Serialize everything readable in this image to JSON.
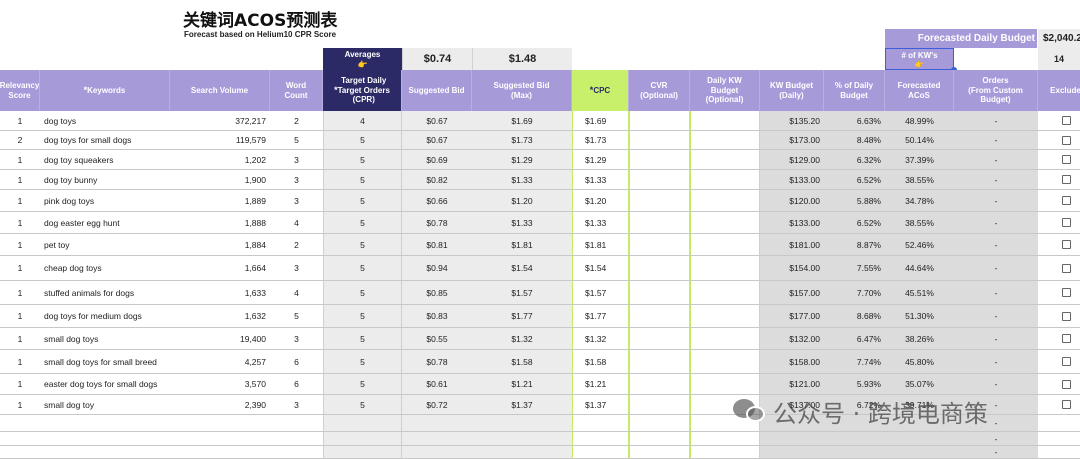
{
  "title": "关键词ACOS预测表",
  "subtitle": "Forecast based on Helium10 CPR Score",
  "averages": {
    "label": "Averages",
    "hand": "👉",
    "suggested_bid": "$0.74",
    "suggested_bid_max": "$1.48"
  },
  "forecast": {
    "label": "Forecasted Daily Budget",
    "value": "$2,040.2",
    "kw_label": "# of KW's",
    "kw_hand": "👉",
    "kw_count": "14"
  },
  "columns": [
    {
      "key": "relevancy",
      "label": "Relevancy\nScore"
    },
    {
      "key": "keyword",
      "label": "Keywords",
      "star": "*"
    },
    {
      "key": "volume",
      "label": "Search Volume"
    },
    {
      "key": "words",
      "label": "Word\nCount"
    },
    {
      "key": "target",
      "label": "Target Daily\nTarget Orders\n(CPR)",
      "star": "*"
    },
    {
      "key": "bid",
      "label": "Suggested Bid"
    },
    {
      "key": "bidmax",
      "label": "Suggested Bid\n(Max)"
    },
    {
      "key": "cpc",
      "label": "CPC",
      "star": "*"
    },
    {
      "key": "cvr",
      "label": "CVR\n(Optional)"
    },
    {
      "key": "dkw",
      "label": "Daily KW\nBudget\n(Optional)"
    },
    {
      "key": "kwb",
      "label": "KW Budget\n(Daily)"
    },
    {
      "key": "pct",
      "label": "% of Daily\nBudget"
    },
    {
      "key": "facos",
      "label": "Forecasted\nACoS"
    },
    {
      "key": "orders",
      "label": "Orders\n(From Custom\nBudget)"
    },
    {
      "key": "exclude",
      "label": "Exclude"
    }
  ],
  "rows": [
    {
      "relevancy": "1",
      "keyword": "dog toys",
      "volume": "372,217",
      "words": "2",
      "target": "4",
      "bid": "$0.67",
      "bidmax": "$1.69",
      "cpc": "$1.69",
      "kwb": "$135.20",
      "pct": "6.63%",
      "facos": "48.99%",
      "orders": "-"
    },
    {
      "relevancy": "2",
      "keyword": "dog toys for small dogs",
      "volume": "119,579",
      "words": "5",
      "target": "5",
      "bid": "$0.67",
      "bidmax": "$1.73",
      "cpc": "$1.73",
      "kwb": "$173.00",
      "pct": "8.48%",
      "facos": "50.14%",
      "orders": "-"
    },
    {
      "relevancy": "1",
      "keyword": "dog toy squeakers",
      "volume": "1,202",
      "words": "3",
      "target": "5",
      "bid": "$0.69",
      "bidmax": "$1.29",
      "cpc": "$1.29",
      "kwb": "$129.00",
      "pct": "6.32%",
      "facos": "37.39%",
      "orders": "-"
    },
    {
      "relevancy": "1",
      "keyword": "dog toy bunny",
      "volume": "1,900",
      "words": "3",
      "target": "5",
      "bid": "$0.82",
      "bidmax": "$1.33",
      "cpc": "$1.33",
      "kwb": "$133.00",
      "pct": "6.52%",
      "facos": "38.55%",
      "orders": "-"
    },
    {
      "relevancy": "1",
      "keyword": "pink dog toys",
      "volume": "1,889",
      "words": "3",
      "target": "5",
      "bid": "$0.66",
      "bidmax": "$1.20",
      "cpc": "$1.20",
      "kwb": "$120.00",
      "pct": "5.88%",
      "facos": "34.78%",
      "orders": "-"
    },
    {
      "relevancy": "1",
      "keyword": "dog easter egg hunt",
      "volume": "1,888",
      "words": "4",
      "target": "5",
      "bid": "$0.78",
      "bidmax": "$1.33",
      "cpc": "$1.33",
      "kwb": "$133.00",
      "pct": "6.52%",
      "facos": "38.55%",
      "orders": "-"
    },
    {
      "relevancy": "1",
      "keyword": "pet toy",
      "volume": "1,884",
      "words": "2",
      "target": "5",
      "bid": "$0.81",
      "bidmax": "$1.81",
      "cpc": "$1.81",
      "kwb": "$181.00",
      "pct": "8.87%",
      "facos": "52.46%",
      "orders": "-"
    },
    {
      "relevancy": "1",
      "keyword": "cheap dog toys",
      "volume": "1,664",
      "words": "3",
      "target": "5",
      "bid": "$0.94",
      "bidmax": "$1.54",
      "cpc": "$1.54",
      "kwb": "$154.00",
      "pct": "7.55%",
      "facos": "44.64%",
      "orders": "-"
    },
    {
      "relevancy": "1",
      "keyword": "stuffed animals for dogs",
      "volume": "1,633",
      "words": "4",
      "target": "5",
      "bid": "$0.85",
      "bidmax": "$1.57",
      "cpc": "$1.57",
      "kwb": "$157.00",
      "pct": "7.70%",
      "facos": "45.51%",
      "orders": "-"
    },
    {
      "relevancy": "1",
      "keyword": "dog toys for medium dogs",
      "volume": "1,632",
      "words": "5",
      "target": "5",
      "bid": "$0.83",
      "bidmax": "$1.77",
      "cpc": "$1.77",
      "kwb": "$177.00",
      "pct": "8.68%",
      "facos": "51.30%",
      "orders": "-"
    },
    {
      "relevancy": "1",
      "keyword": "small dog toys",
      "volume": "19,400",
      "words": "3",
      "target": "5",
      "bid": "$0.55",
      "bidmax": "$1.32",
      "cpc": "$1.32",
      "kwb": "$132.00",
      "pct": "6.47%",
      "facos": "38.26%",
      "orders": "-"
    },
    {
      "relevancy": "1",
      "keyword": "small dog toys for small breed",
      "volume": "4,257",
      "words": "6",
      "target": "5",
      "bid": "$0.78",
      "bidmax": "$1.58",
      "cpc": "$1.58",
      "kwb": "$158.00",
      "pct": "7.74%",
      "facos": "45.80%",
      "orders": "-"
    },
    {
      "relevancy": "1",
      "keyword": "easter dog toys for small dogs",
      "volume": "3,570",
      "words": "6",
      "target": "5",
      "bid": "$0.61",
      "bidmax": "$1.21",
      "cpc": "$1.21",
      "kwb": "$121.00",
      "pct": "5.93%",
      "facos": "35.07%",
      "orders": "-"
    },
    {
      "relevancy": "1",
      "keyword": "small dog toy",
      "volume": "2,390",
      "words": "3",
      "target": "5",
      "bid": "$0.72",
      "bidmax": "$1.37",
      "cpc": "$1.37",
      "kwb": "$137.00",
      "pct": "6.72%",
      "facos": "39.71%",
      "orders": "-"
    },
    {
      "relevancy": "",
      "keyword": "",
      "volume": "",
      "words": "",
      "target": "",
      "bid": "",
      "bidmax": "",
      "cpc": "",
      "kwb": "",
      "pct": "",
      "facos": "",
      "orders": "-"
    },
    {
      "relevancy": "",
      "keyword": "",
      "volume": "",
      "words": "",
      "target": "",
      "bid": "",
      "bidmax": "",
      "cpc": "",
      "kwb": "",
      "pct": "",
      "facos": "",
      "orders": "-"
    },
    {
      "relevancy": "",
      "keyword": "",
      "volume": "",
      "words": "",
      "target": "",
      "bid": "",
      "bidmax": "",
      "cpc": "",
      "kwb": "",
      "pct": "",
      "facos": "",
      "orders": "-"
    }
  ],
  "watermark": "公众号 · 跨境电商策",
  "colors": {
    "header": "#a79ad9",
    "accent_green": "#c9f06a",
    "navy": "#2b2a66",
    "grey": "#ececec"
  }
}
